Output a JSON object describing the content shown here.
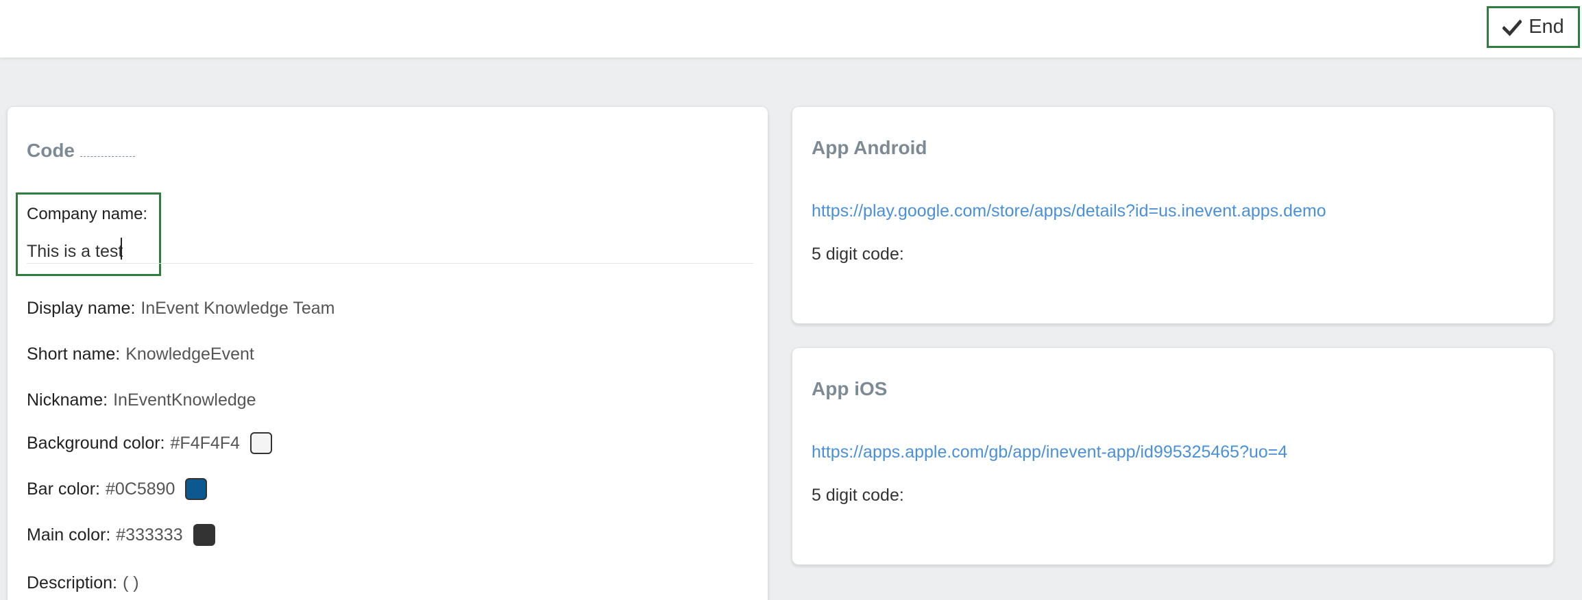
{
  "header": {
    "end_label": "End"
  },
  "left_panel": {
    "code_title": "Code",
    "company": {
      "label": "Company name:",
      "value": "This is a test"
    },
    "fields": {
      "display_name": {
        "label": "Display name:",
        "value": "InEvent Knowledge Team"
      },
      "short_name": {
        "label": "Short name:",
        "value": "KnowledgeEvent"
      },
      "nickname": {
        "label": "Nickname:",
        "value": "InEventKnowledge"
      },
      "background_color": {
        "label": "Background color:",
        "value": "#F4F4F4",
        "swatch": "#F4F4F4"
      },
      "bar_color": {
        "label": "Bar color:",
        "value": "#0C5890",
        "swatch": "#0C5890"
      },
      "main_color": {
        "label": "Main color:",
        "value": "#333333",
        "swatch": "#333333"
      },
      "description": {
        "label": "Description:",
        "value": "( )"
      }
    }
  },
  "android": {
    "title": "App Android",
    "link": "https://play.google.com/store/apps/details?id=us.inevent.apps.demo",
    "code_label": "5 digit code:"
  },
  "ios": {
    "title": "App iOS",
    "link": "https://apps.apple.com/gb/app/inevent-app/id995325465?uo=4",
    "code_label": "5 digit code:"
  },
  "icons": {
    "end": "check-icon"
  }
}
